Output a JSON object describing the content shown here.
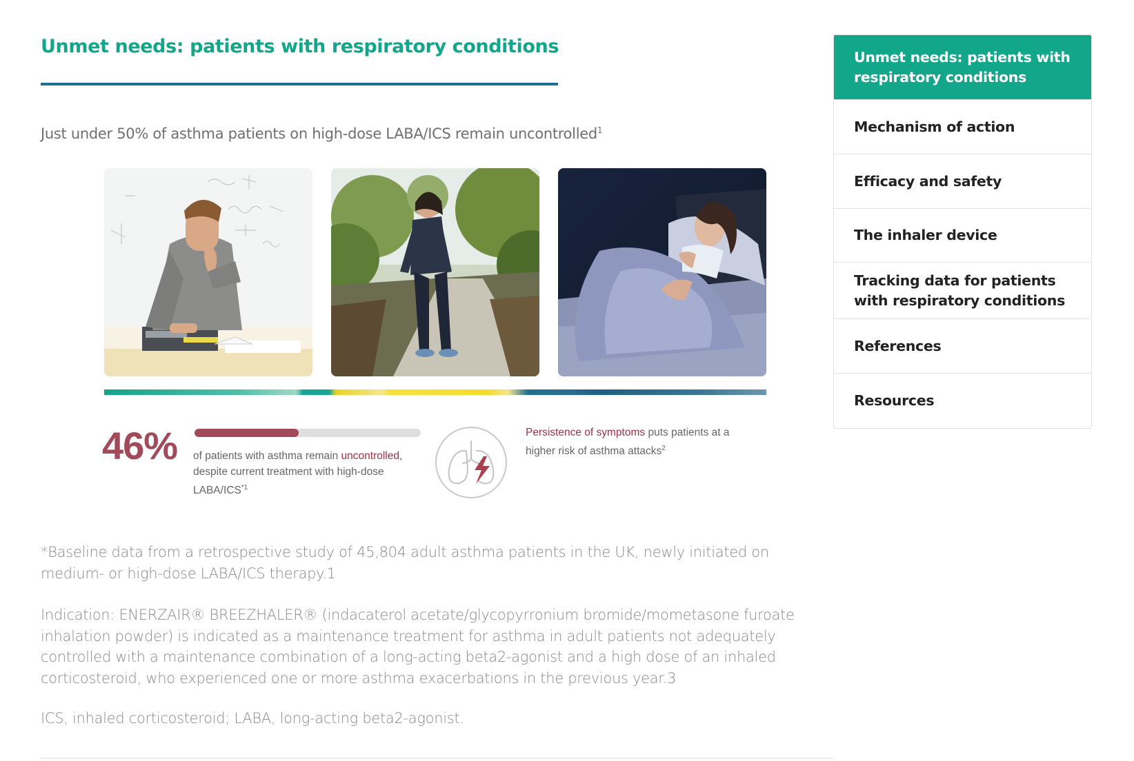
{
  "page": {
    "title": "Unmet needs: patients with respiratory conditions",
    "subtitle": "Just under 50% of asthma patients on high-dose LABA/ICS remain uncontrolled",
    "subtitle_sup": "1"
  },
  "stats": {
    "uncontrolled_value": "46%",
    "uncontrolled_fraction": 0.46,
    "desc_before": "of patients with asthma remain ",
    "desc_accent": "uncontrolled",
    "desc_after": ", despite current treatment with high-dose LABA/ICS",
    "desc_sup": "*1",
    "risk_accent": "Persistence of symptoms",
    "risk_after": " puts patients at a higher risk of asthma attacks",
    "risk_sup": "2"
  },
  "notes": {
    "baseline": "*Baseline data from a retrospective study of 45,804 adult asthma patients in the UK, newly initiated on medium- or high-dose LABA/ICS therapy.1",
    "indication": "Indication: ENERZAIR® BREEZHALER® (indacaterol acetate/glycopyrronium bromide/mometasone furoate inhalation powder) is indicated as a maintenance treatment for asthma in adult patients not adequately controlled with a maintenance combination of a long-acting beta2-agonist and a high dose of an inhaled corticosteroid, who experienced one or more asthma exacerbations in the previous year.3",
    "abbreviations": "ICS, inhaled corticosteroid; LABA, long-acting beta2-agonist."
  },
  "sidebar": {
    "items": [
      {
        "label": "Unmet needs: patients with respiratory conditions",
        "active": true
      },
      {
        "label": "Mechanism of action",
        "active": false
      },
      {
        "label": "Efficacy and safety",
        "active": false
      },
      {
        "label": "The inhaler device",
        "active": false
      },
      {
        "label": "Tracking data for patients with respiratory conditions",
        "active": false
      },
      {
        "label": "References",
        "active": false
      },
      {
        "label": "Resources",
        "active": false
      }
    ]
  },
  "colors": {
    "brand_green": "#12a68b",
    "accent_red": "#a24a59",
    "rule_blue": "#1d6e8f"
  },
  "icons": {
    "lungs": "lungs-lightning-icon"
  }
}
